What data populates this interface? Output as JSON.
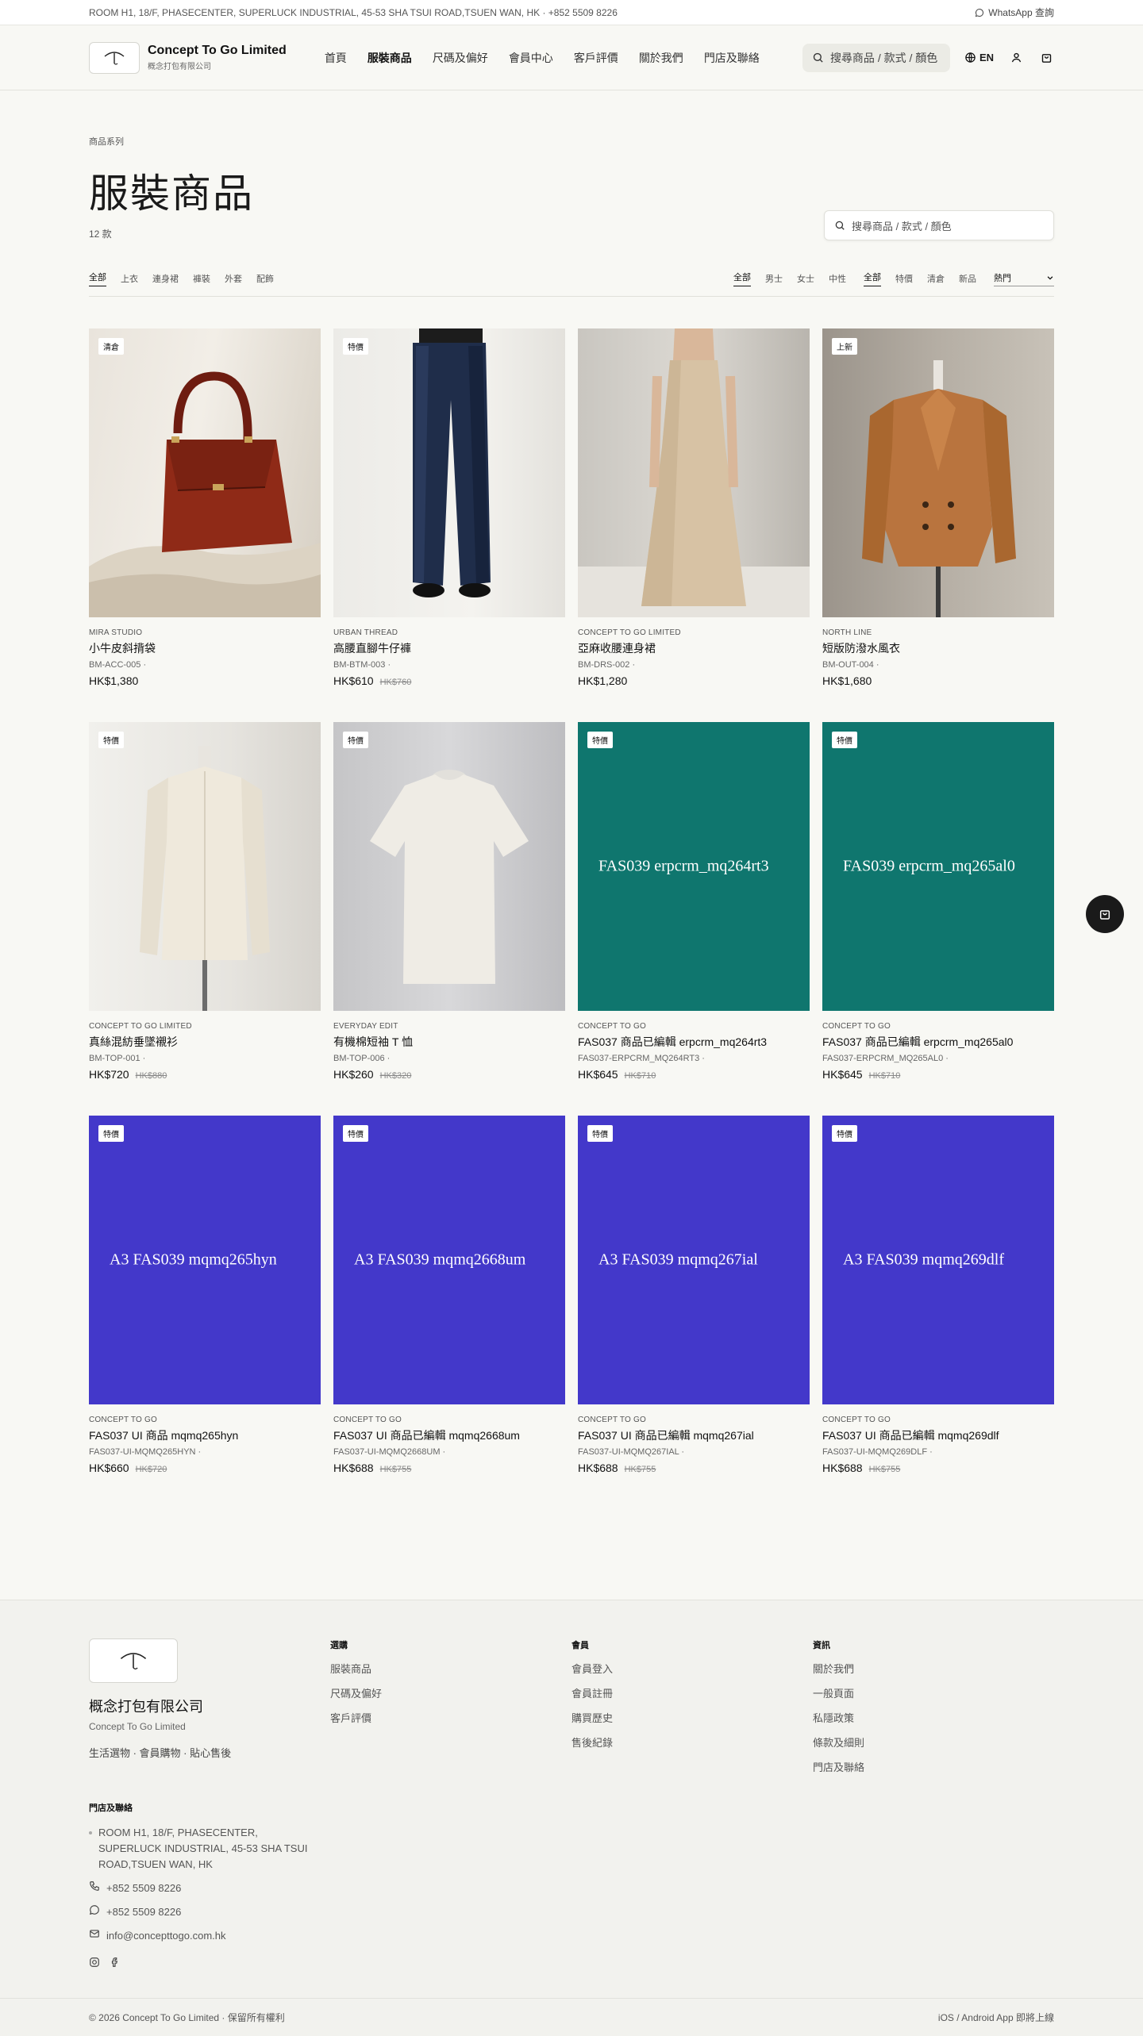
{
  "topbar": {
    "address": "ROOM H1, 18/F, PHASECENTER, SUPERLUCK INDUSTRIAL, 45-53 SHA TSUI ROAD,TSUEN WAN, HK · +852 5509 8226",
    "whatsapp": "WhatsApp 查詢"
  },
  "header": {
    "brand_name": "Concept To Go Limited",
    "brand_sub": "概念打包有限公司",
    "nav": [
      "首頁",
      "服裝商品",
      "尺碼及偏好",
      "會員中心",
      "客戶評價",
      "關於我們",
      "門店及聯絡"
    ],
    "search_placeholder": "搜尋商品 / 款式 / 顏色",
    "lang": "EN"
  },
  "page": {
    "breadcrumb": "商品系列",
    "title": "服裝商品",
    "count": "12 款",
    "search_placeholder": "搜尋商品 / 款式 / 顏色"
  },
  "filters": {
    "categories": [
      "全部",
      "上衣",
      "連身裙",
      "褲裝",
      "外套",
      "配飾"
    ],
    "genders": [
      "全部",
      "男士",
      "女士",
      "中性"
    ],
    "tags": [
      "全部",
      "特價",
      "清倉",
      "新品"
    ],
    "sort": "熱門"
  },
  "products": [
    {
      "badge": "清倉",
      "brand": "MIRA STUDIO",
      "name": "小牛皮斜揹袋",
      "sku": "BM-ACC-005 ·",
      "price": "HK$1,380",
      "old_price": ""
    },
    {
      "badge": "特價",
      "brand": "URBAN THREAD",
      "name": "高腰直腳牛仔褲",
      "sku": "BM-BTM-003 ·",
      "price": "HK$610",
      "old_price": "HK$760"
    },
    {
      "badge": "",
      "brand": "CONCEPT TO GO LIMITED",
      "name": "亞麻收腰連身裙",
      "sku": "BM-DRS-002 ·",
      "price": "HK$1,280",
      "old_price": ""
    },
    {
      "badge": "上新",
      "brand": "NORTH LINE",
      "name": "短版防潑水風衣",
      "sku": "BM-OUT-004 ·",
      "price": "HK$1,680",
      "old_price": ""
    },
    {
      "badge": "特價",
      "brand": "CONCEPT TO GO LIMITED",
      "name": "真絲混紡垂墜襯衫",
      "sku": "BM-TOP-001 ·",
      "price": "HK$720",
      "old_price": "HK$880"
    },
    {
      "badge": "特價",
      "brand": "EVERYDAY EDIT",
      "name": "有機棉短袖 T 恤",
      "sku": "BM-TOP-006 ·",
      "price": "HK$260",
      "old_price": "HK$320"
    },
    {
      "badge": "特價",
      "brand": "CONCEPT TO GO",
      "name": "FAS037 商品已編輯 erpcrm_mq264rt3",
      "sku": "FAS037-ERPCRM_MQ264RT3 ·",
      "price": "HK$645",
      "old_price": "HK$710",
      "placeholder": "FAS039 erpcrm_mq264rt3"
    },
    {
      "badge": "特價",
      "brand": "CONCEPT TO GO",
      "name": "FAS037 商品已編輯 erpcrm_mq265al0",
      "sku": "FAS037-ERPCRM_MQ265AL0 ·",
      "price": "HK$645",
      "old_price": "HK$710",
      "placeholder": "FAS039 erpcrm_mq265al0"
    },
    {
      "badge": "特價",
      "brand": "CONCEPT TO GO",
      "name": "FAS037 UI 商品 mqmq265hyn",
      "sku": "FAS037-UI-MQMQ265HYN ·",
      "price": "HK$660",
      "old_price": "HK$720",
      "placeholder": "A3 FAS039 mqmq265hyn"
    },
    {
      "badge": "特價",
      "brand": "CONCEPT TO GO",
      "name": "FAS037 UI 商品已編輯 mqmq2668um",
      "sku": "FAS037-UI-MQMQ2668UM ·",
      "price": "HK$688",
      "old_price": "HK$755",
      "placeholder": "A3 FAS039 mqmq2668um"
    },
    {
      "badge": "特價",
      "brand": "CONCEPT TO GO",
      "name": "FAS037 UI 商品已編輯 mqmq267ial",
      "sku": "FAS037-UI-MQMQ267IAL ·",
      "price": "HK$688",
      "old_price": "HK$755",
      "placeholder": "A3 FAS039 mqmq267ial"
    },
    {
      "badge": "特價",
      "brand": "CONCEPT TO GO",
      "name": "FAS037 UI 商品已編輯 mqmq269dlf",
      "sku": "FAS037-UI-MQMQ269DLF ·",
      "price": "HK$688",
      "old_price": "HK$755",
      "placeholder": "A3 FAS039 mqmq269dlf"
    }
  ],
  "colors": {
    "teal_placeholder": "#0f766e",
    "indigo_placeholder": "#4338ca",
    "background": "#f8f8f4"
  },
  "footer": {
    "company": "概念打包有限公司",
    "company_en": "Concept To Go Limited",
    "tagline": "生活選物 · 會員購物 · 貼心售後",
    "col_shop_title": "選購",
    "col_shop": [
      "服裝商品",
      "尺碼及偏好",
      "客戶評價"
    ],
    "col_member_title": "會員",
    "col_member": [
      "會員登入",
      "會員註冊",
      "購買歷史",
      "售後紀錄"
    ],
    "col_info_title": "資訊",
    "col_info": [
      "關於我們",
      "一般頁面",
      "私隱政策",
      "條款及細則",
      "門店及聯絡"
    ],
    "store_title": "門店及聯絡",
    "store_address": "ROOM H1, 18/F, PHASECENTER, SUPERLUCK INDUSTRIAL, 45-53 SHA TSUI ROAD,TSUEN WAN, HK",
    "phone": "+852 5509 8226",
    "whatsapp": "+852 5509 8226",
    "email": "info@concepttogo.com.hk",
    "copyright": "© 2026 Concept To Go Limited · 保留所有權利",
    "app_note": "iOS / Android App 即將上線"
  }
}
